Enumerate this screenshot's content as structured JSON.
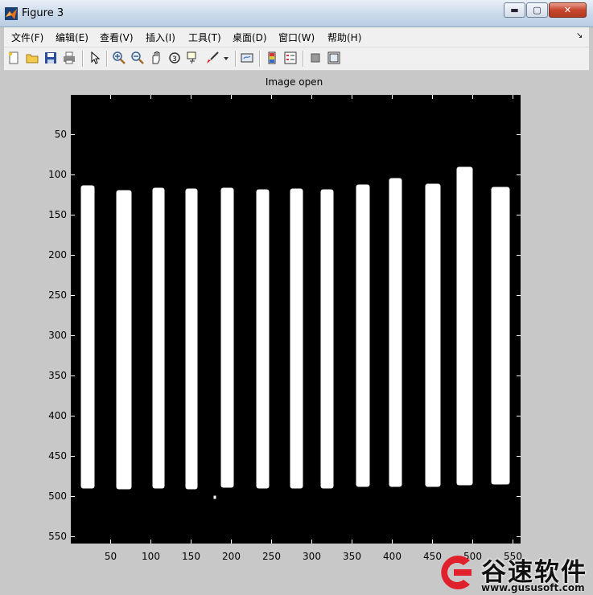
{
  "window": {
    "title": "Figure 3",
    "controls": {
      "minimize": "▬",
      "maximize": "▢",
      "close": "✕"
    }
  },
  "menu": {
    "items": [
      "文件(F)",
      "编辑(E)",
      "查看(V)",
      "插入(I)",
      "工具(T)",
      "桌面(D)",
      "窗口(W)",
      "帮助(H)"
    ],
    "overflow": "↘"
  },
  "toolbar": {
    "buttons": [
      "new-figure",
      "open-file",
      "save",
      "print",
      "edit-plot-arrow",
      "zoom-in",
      "zoom-out",
      "pan",
      "rotate-3d",
      "data-cursor",
      "brush",
      "brush-dropdown",
      "link-plot",
      "colorbar",
      "legend",
      "hide-plot-tools",
      "show-plot-tools"
    ]
  },
  "axes": {
    "title": "Image open",
    "xlim": [
      0.5,
      559.5
    ],
    "ylim": [
      0.5,
      558.5
    ],
    "y_ticks": [
      "50",
      "100",
      "150",
      "200",
      "250",
      "300",
      "350",
      "400",
      "450",
      "500",
      "550"
    ],
    "x_ticks": [
      "50",
      "100",
      "150",
      "200",
      "250",
      "300",
      "350",
      "400",
      "450",
      "500",
      "550"
    ],
    "y_reversed": true
  },
  "image": {
    "colormap": "binary",
    "background": "#000000",
    "foreground": "#ffffff",
    "bars": [
      {
        "x_left": 13,
        "x_right": 30,
        "y_top": 113,
        "y_bottom": 490
      },
      {
        "x_left": 57,
        "x_right": 76,
        "y_top": 119,
        "y_bottom": 491
      },
      {
        "x_left": 102,
        "x_right": 117,
        "y_top": 116,
        "y_bottom": 490
      },
      {
        "x_left": 143,
        "x_right": 158,
        "y_top": 117,
        "y_bottom": 491
      },
      {
        "x_left": 187,
        "x_right": 203,
        "y_top": 116,
        "y_bottom": 489
      },
      {
        "x_left": 231,
        "x_right": 247,
        "y_top": 118,
        "y_bottom": 490
      },
      {
        "x_left": 273,
        "x_right": 289,
        "y_top": 117,
        "y_bottom": 490
      },
      {
        "x_left": 311,
        "x_right": 327,
        "y_top": 118,
        "y_bottom": 490
      },
      {
        "x_left": 355,
        "x_right": 372,
        "y_top": 112,
        "y_bottom": 488
      },
      {
        "x_left": 396,
        "x_right": 412,
        "y_top": 104,
        "y_bottom": 488
      },
      {
        "x_left": 441,
        "x_right": 460,
        "y_top": 111,
        "y_bottom": 488
      },
      {
        "x_left": 480,
        "x_right": 500,
        "y_top": 90,
        "y_bottom": 486
      },
      {
        "x_left": 523,
        "x_right": 546,
        "y_top": 115,
        "y_bottom": 485
      }
    ],
    "speck": {
      "x": 178,
      "y": 499
    }
  },
  "watermark": {
    "name": "谷速软件",
    "url": "www.gususoft.com",
    "logo_letter": "G",
    "logo_color": "#e0202a"
  }
}
